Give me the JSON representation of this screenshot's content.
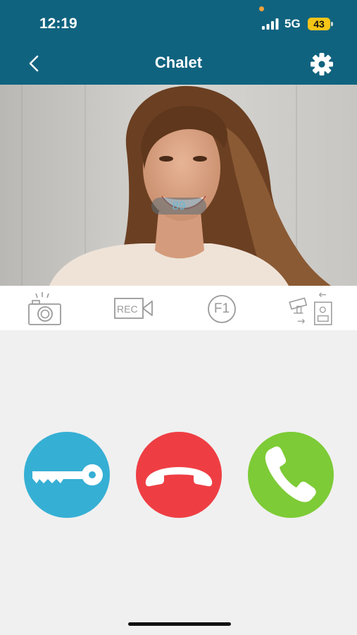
{
  "status_bar": {
    "time": "12:19",
    "network": "5G",
    "battery": "43"
  },
  "header": {
    "title": "Chalet"
  },
  "video": {
    "overlay_value": "89"
  },
  "toolbar": {
    "items": [
      {
        "icon": "camera-snapshot-icon"
      },
      {
        "icon": "record-video-icon",
        "label": "REC"
      },
      {
        "icon": "function-key-icon",
        "label": "F1"
      },
      {
        "icon": "switch-camera-icon"
      }
    ]
  },
  "actions": [
    {
      "icon": "key-icon",
      "color": "#36afd4"
    },
    {
      "icon": "hang-up-icon",
      "color": "#ee3e44"
    },
    {
      "icon": "answer-call-icon",
      "color": "#7dcb36"
    }
  ]
}
